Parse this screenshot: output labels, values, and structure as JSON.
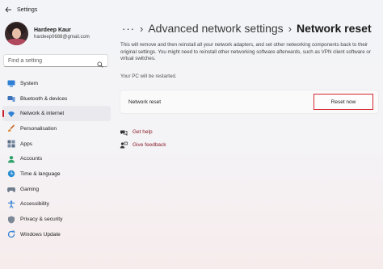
{
  "window": {
    "title": "Settings"
  },
  "user": {
    "name": "Hardeep Kaur",
    "email": "hardeep0688@gmail.com"
  },
  "search": {
    "placeholder": "Find a setting"
  },
  "nav": {
    "items": [
      {
        "label": "System",
        "icon": "system-icon"
      },
      {
        "label": "Bluetooth & devices",
        "icon": "bluetooth-icon"
      },
      {
        "label": "Network & internet",
        "icon": "network-icon",
        "active": true
      },
      {
        "label": "Personalisation",
        "icon": "brush-icon"
      },
      {
        "label": "Apps",
        "icon": "apps-icon"
      },
      {
        "label": "Accounts",
        "icon": "accounts-icon"
      },
      {
        "label": "Time & language",
        "icon": "globe-clock-icon"
      },
      {
        "label": "Gaming",
        "icon": "gamepad-icon"
      },
      {
        "label": "Accessibility",
        "icon": "accessibility-icon"
      },
      {
        "label": "Privacy & security",
        "icon": "shield-icon"
      },
      {
        "label": "Windows Update",
        "icon": "update-icon"
      }
    ]
  },
  "breadcrumb": {
    "dots": "···",
    "separator": "›",
    "parent": "Advanced network settings",
    "current": "Network reset"
  },
  "main": {
    "description": "This will remove and then reinstall all your network adapters, and set other networking components back to their original settings. You might need to reinstall other networking software afterwards, such as VPN client software or virtual switches.",
    "restart_note": "Your PC will be restarted.",
    "card_label": "Network reset",
    "reset_button": "Reset now",
    "links": [
      {
        "label": "Get help",
        "icon": "help-icon"
      },
      {
        "label": "Give feedback",
        "icon": "feedback-icon"
      }
    ]
  },
  "colors": {
    "accent": "#c8202a",
    "link": "#8a1f2a",
    "highlight_border": "#d4282f"
  }
}
